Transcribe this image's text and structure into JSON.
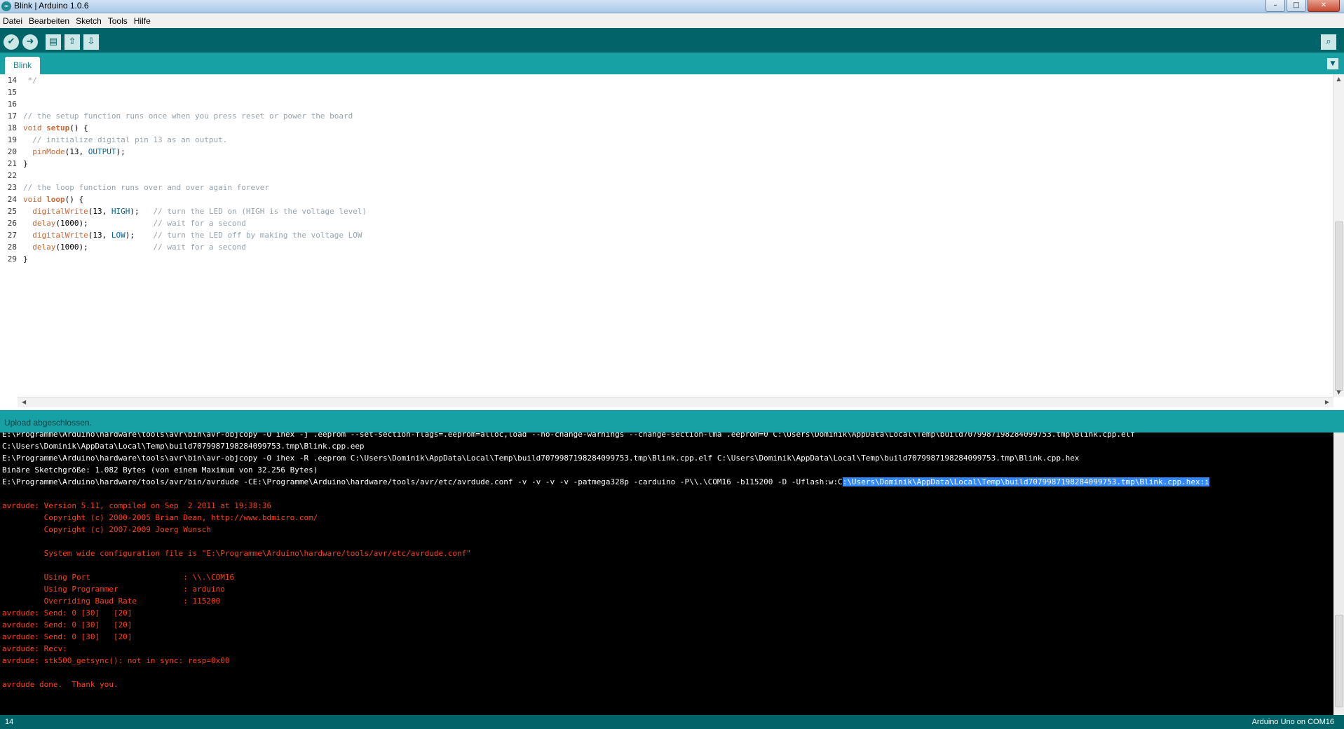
{
  "window": {
    "title": "Blink | Arduino 1.0.6",
    "icon": "arduino-logo-icon",
    "buttons": [
      "minimize",
      "maximize",
      "close"
    ]
  },
  "menu": [
    "Datei",
    "Bearbeiten",
    "Sketch",
    "Tools",
    "Hilfe"
  ],
  "toolbar": {
    "buttons": [
      "verify-icon",
      "upload-icon",
      "new-icon",
      "open-icon",
      "save-icon"
    ],
    "serial_monitor": "serial-monitor-icon"
  },
  "tabs": [
    {
      "label": "Blink",
      "active": true
    }
  ],
  "editor": {
    "lines": [
      {
        "n": "14",
        "text": " */"
      },
      {
        "n": "15",
        "text": ""
      },
      {
        "n": "16",
        "text": ""
      },
      {
        "n": "17",
        "text": "// the setup function runs once when you press reset or power the board"
      },
      {
        "n": "18",
        "text": "void setup() {"
      },
      {
        "n": "19",
        "text": "  // initialize digital pin 13 as an output."
      },
      {
        "n": "20",
        "text": "  pinMode(13, OUTPUT);"
      },
      {
        "n": "21",
        "text": "}"
      },
      {
        "n": "22",
        "text": ""
      },
      {
        "n": "23",
        "text": "// the loop function runs over and over again forever"
      },
      {
        "n": "24",
        "text": "void loop() {"
      },
      {
        "n": "25",
        "text": "  digitalWrite(13, HIGH);   // turn the LED on (HIGH is the voltage level)"
      },
      {
        "n": "26",
        "text": "  delay(1000);              // wait for a second"
      },
      {
        "n": "27",
        "text": "  digitalWrite(13, LOW);    // turn the LED off by making the voltage LOW"
      },
      {
        "n": "28",
        "text": "  delay(1000);              // wait for a second"
      },
      {
        "n": "29",
        "text": "}"
      }
    ]
  },
  "status": {
    "message": "Upload abgeschlossen."
  },
  "console": {
    "lines": [
      {
        "color": "white",
        "text": "E:\\Programme\\Arduino\\hardware\\tools\\avr\\bin\\avr-objcopy -O ihex -j .eeprom --set-section-flags=.eeprom=alloc,load --no-change-warnings --change-section-lma .eeprom=0 C:\\Users\\Dominik\\AppData\\Local\\Temp\\build7079987198284099753.tmp\\Blink.cpp.elf"
      },
      {
        "color": "white",
        "text": "C:\\Users\\Dominik\\AppData\\Local\\Temp\\build7079987198284099753.tmp\\Blink.cpp.eep"
      },
      {
        "color": "white",
        "text": "E:\\Programme\\Arduino\\hardware\\tools\\avr\\bin\\avr-objcopy -O ihex -R .eeprom C:\\Users\\Dominik\\AppData\\Local\\Temp\\build7079987198284099753.tmp\\Blink.cpp.elf C:\\Users\\Dominik\\AppData\\Local\\Temp\\build7079987198284099753.tmp\\Blink.cpp.hex"
      },
      {
        "color": "white",
        "text": "Binäre Sketchgröße: 1.082 Bytes (von einem Maximum von 32.256 Bytes)"
      },
      {
        "color": "white",
        "text": "E:\\Programme\\Arduino\\hardware/tools/avr/bin/avrdude -CE:\\Programme\\Arduino\\hardware/tools/avr/etc/avrdude.conf -v -v -v -v -patmega328p -carduino -P\\\\.\\COM16 -b115200 -D -Uflash:w:C",
        "selected": ":\\Users\\Dominik\\AppData\\Local\\Temp\\build7079987198284099753.tmp\\Blink.cpp.hex:i"
      },
      {
        "color": "white",
        "text": ""
      },
      {
        "color": "red",
        "text": "avrdude: Version 5.11, compiled on Sep  2 2011 at 19:38:36"
      },
      {
        "color": "red",
        "text": "         Copyright (c) 2000-2005 Brian Dean, http://www.bdmicro.com/"
      },
      {
        "color": "red",
        "text": "         Copyright (c) 2007-2009 Joerg Wunsch"
      },
      {
        "color": "red",
        "text": ""
      },
      {
        "color": "red",
        "text": "         System wide configuration file is \"E:\\Programme\\Arduino\\hardware/tools/avr/etc/avrdude.conf\""
      },
      {
        "color": "red",
        "text": ""
      },
      {
        "color": "red",
        "text": "         Using Port                    : \\\\.\\COM16"
      },
      {
        "color": "red",
        "text": "         Using Programmer              : arduino"
      },
      {
        "color": "red",
        "text": "         Overriding Baud Rate          : 115200"
      },
      {
        "color": "red",
        "text": "avrdude: Send: 0 [30]   [20]"
      },
      {
        "color": "red",
        "text": "avrdude: Send: 0 [30]   [20]"
      },
      {
        "color": "red",
        "text": "avrdude: Send: 0 [30]   [20]"
      },
      {
        "color": "red",
        "text": "avrdude: Recv:"
      },
      {
        "color": "red",
        "text": "avrdude: stk500_getsync(): not in sync: resp=0x00"
      },
      {
        "color": "red",
        "text": ""
      },
      {
        "color": "red",
        "text": "avrdude done.  Thank you."
      }
    ]
  },
  "footer": {
    "line": "14",
    "board": "Arduino Uno on COM16"
  },
  "colors": {
    "toolbar": "#006468",
    "tabbar": "#17a1a5",
    "console_bg": "#000000",
    "console_error": "#ff4010",
    "selection": "#3388ff"
  }
}
